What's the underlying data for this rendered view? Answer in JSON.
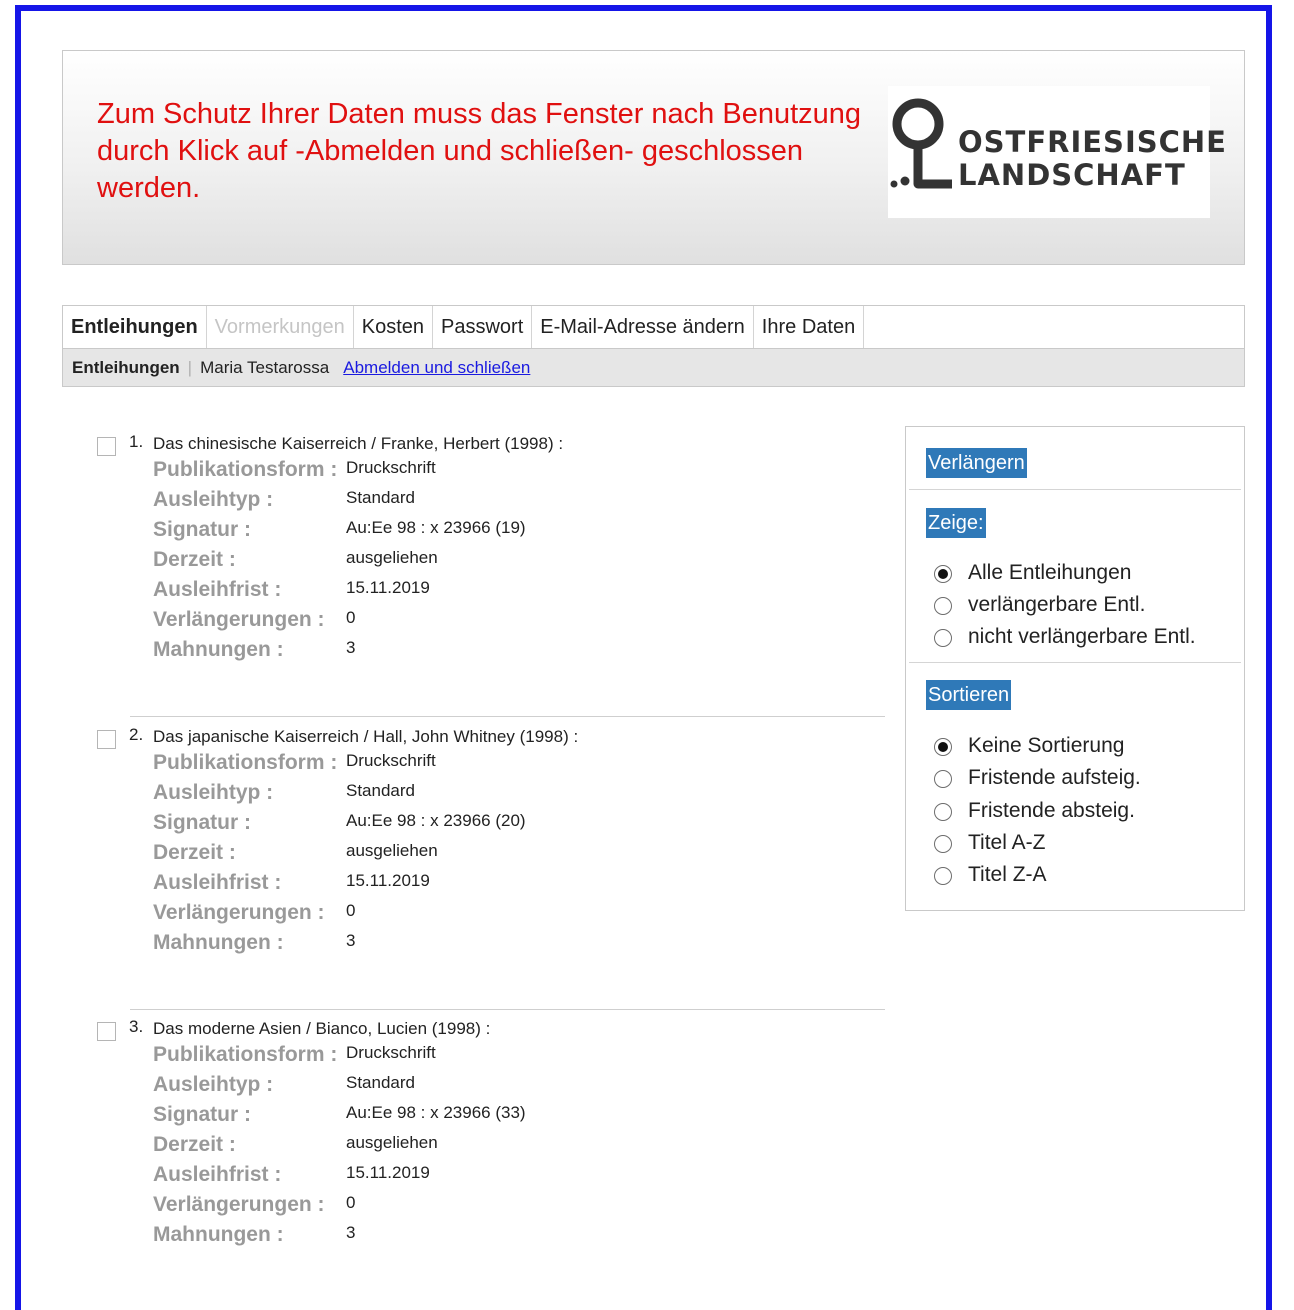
{
  "banner": {
    "notice": "Zum Schutz Ihrer Daten muss das Fenster nach Benutzung durch Klick auf -Abmelden und schließen- geschlossen werden.",
    "logo_text_line1": "OSTFRIESISCHE",
    "logo_text_line2": "LANDSCHAFT"
  },
  "tabs": [
    {
      "label": "Entleihungen"
    },
    {
      "label": "Vormerkungen"
    },
    {
      "label": "Kosten"
    },
    {
      "label": "Passwort"
    },
    {
      "label": "E-Mail-Adresse ändern"
    },
    {
      "label": "Ihre Daten"
    }
  ],
  "subnav": {
    "current": "Entleihungen",
    "separator": "|",
    "user": "Maria Testarossa",
    "logout_link": "Abmelden und schließen"
  },
  "labels": {
    "form": "Publikationsform :",
    "type": "Ausleihtyp :",
    "signature": "Signatur :",
    "status": "Derzeit :",
    "due": "Ausleihfrist :",
    "renewals": "Verlängerungen :",
    "reminders": "Mahnungen :"
  },
  "entries": [
    {
      "num": "1.",
      "title": "Das chinesische Kaiserreich / Franke, Herbert (1998) :",
      "form": "Druckschrift",
      "type": "Standard",
      "signature": "Au:Ee 98 : x 23966 (19)",
      "status": "ausgeliehen",
      "due": "15.11.2019",
      "renewals": "0",
      "reminders": "3"
    },
    {
      "num": "2.",
      "title": "Das japanische Kaiserreich / Hall, John Whitney (1998) :",
      "form": "Druckschrift",
      "type": "Standard",
      "signature": "Au:Ee 98 : x 23966 (20)",
      "status": "ausgeliehen",
      "due": "15.11.2019",
      "renewals": "0",
      "reminders": "3"
    },
    {
      "num": "3.",
      "title": "Das moderne Asien / Bianco, Lucien (1998) :",
      "form": "Druckschrift",
      "type": "Standard",
      "signature": "Au:Ee 98 : x 23966 (33)",
      "status": "ausgeliehen",
      "due": "15.11.2019",
      "renewals": "0",
      "reminders": "3"
    }
  ],
  "sidebar": {
    "renew_button": "Verlängern",
    "show_heading": "Zeige:",
    "show_options": [
      "Alle Entleihungen",
      "verlängerbare Entl.",
      "nicht verlängerbare Entl."
    ],
    "sort_heading": "Sortieren",
    "sort_options": [
      "Keine Sortierung",
      "Fristende aufsteig.",
      "Fristende absteig.",
      "Titel A-Z",
      "Titel Z-A"
    ]
  },
  "colors": {
    "frame": "#1515e8",
    "notice": "#e01010",
    "accent": "#2f79b8",
    "link": "#1a1ae0"
  }
}
